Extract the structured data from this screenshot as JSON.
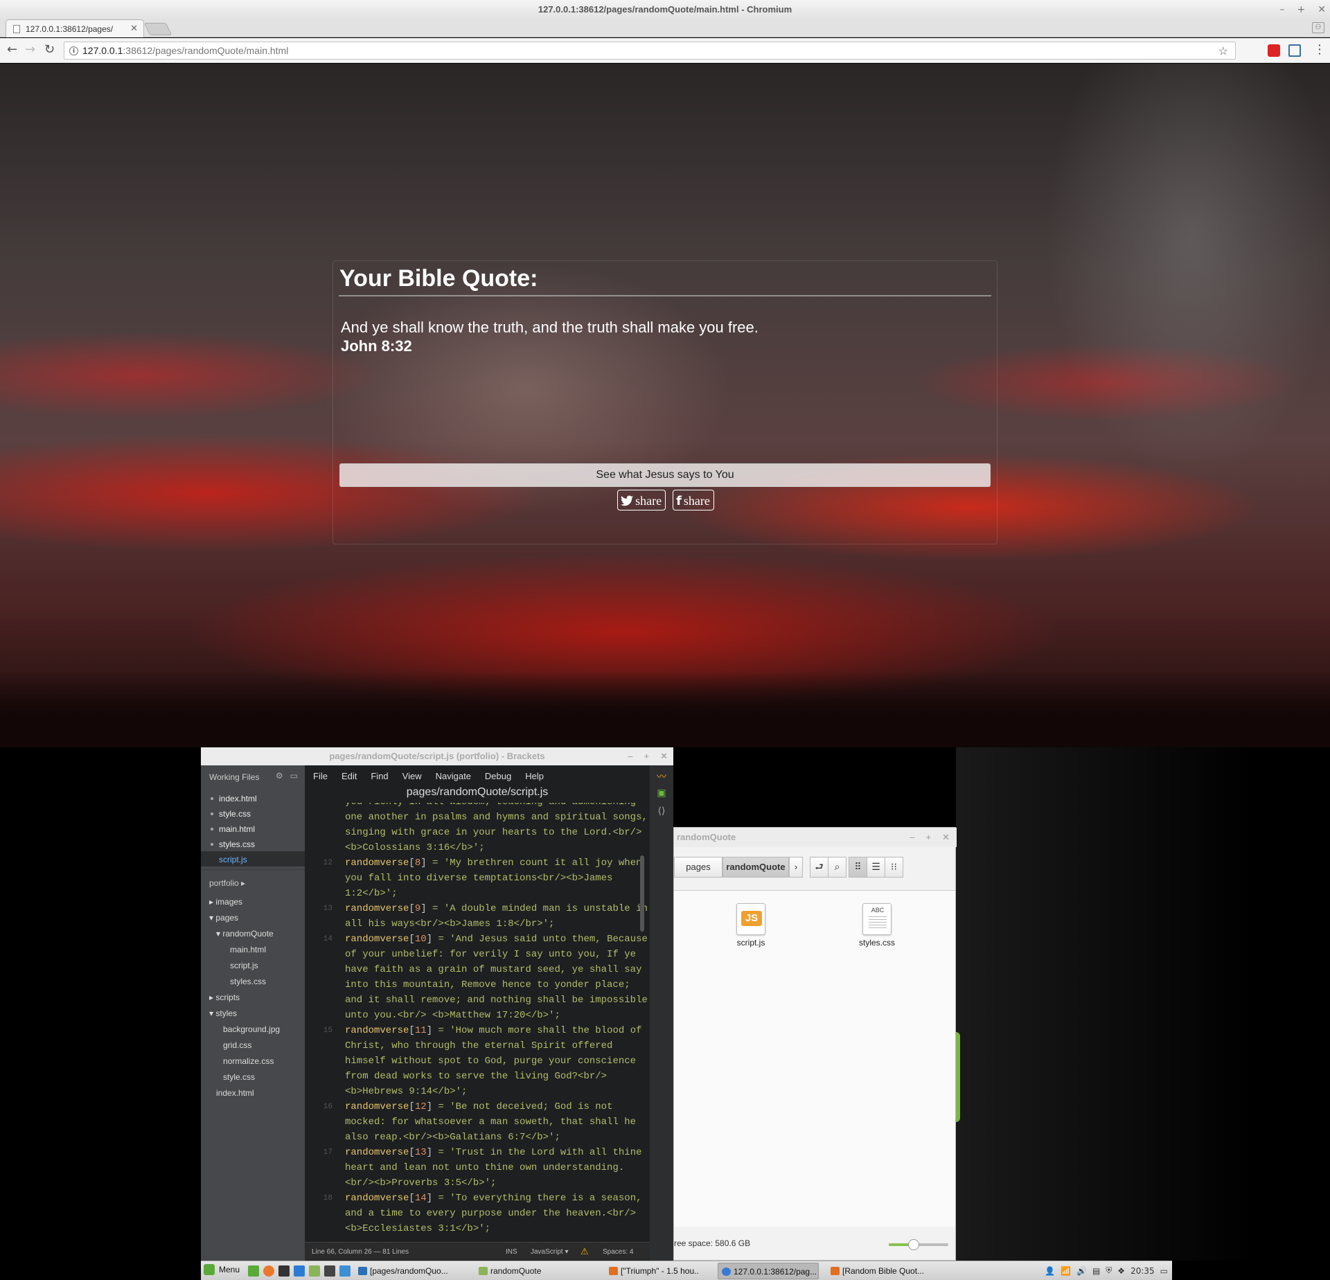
{
  "window": {
    "title": "127.0.0.1:38612/pages/randomQuote/main.html - Chromium",
    "minimize": "–",
    "maximize": "+",
    "close": "✕"
  },
  "browser": {
    "tab_title": "127.0.0.1:38612/pages/",
    "tab_close": "✕",
    "profile": "⚇",
    "url_host": "127.0.0.1",
    "url_rest": ":38612/pages/randomQuote/main.html",
    "back": "←",
    "forward": "→",
    "reload": "↻",
    "star": "☆",
    "info": "i",
    "menu": "⋮"
  },
  "quote_page": {
    "heading": "Your Bible Quote:",
    "quote": "And ye shall know the truth, and the truth shall make you free.",
    "reference": "John 8:32",
    "button_label": "See what Jesus says to You",
    "twitter_share": "share",
    "facebook_share": "share",
    "twitter_icon": "twitter-bird",
    "facebook_icon": "f"
  },
  "brackets": {
    "title": "pages/randomQuote/script.js (portfolio) - Brackets",
    "ctrl_min": "–",
    "ctrl_max": "+",
    "ctrl_close": "✕",
    "working_files_label": "Working Files",
    "working_files": [
      "index.html",
      "style.css",
      "main.html",
      "styles.css",
      "script.js"
    ],
    "project_label": "portfolio ▸",
    "tree": [
      {
        "label": "▸ images"
      },
      {
        "label": "▾ pages"
      },
      {
        "label": "▾ randomQuote"
      },
      {
        "label": "main.html"
      },
      {
        "label": "script.js"
      },
      {
        "label": "styles.css"
      },
      {
        "label": "▸ scripts"
      },
      {
        "label": "▾ styles"
      },
      {
        "label": "background.jpg"
      },
      {
        "label": "grid.css"
      },
      {
        "label": "normalize.css"
      },
      {
        "label": "style.css"
      },
      {
        "label": "index.html"
      }
    ],
    "menu": [
      "File",
      "Edit",
      "Find",
      "View",
      "Navigate",
      "Debug",
      "Help"
    ],
    "file_path": "pages/randomQuote/script.js",
    "code": [
      {
        "ln": "",
        "text": "you richly in all wisdom; teaching and admonishing"
      },
      {
        "ln": "",
        "text": "one another in psalms and hymns and spiritual songs,"
      },
      {
        "ln": "",
        "text": "singing with grace in your hearts to the Lord.<br/>"
      },
      {
        "ln": "",
        "text": "<b>Colossians 3:16</b>';"
      },
      {
        "ln": "12",
        "kw": "randomverse",
        "num": "8",
        "text": " = 'My brethren count it all joy when"
      },
      {
        "ln": "",
        "text": "you fall into diverse temptations<br/><b>James"
      },
      {
        "ln": "",
        "text": "1:2</b>';"
      },
      {
        "ln": "13",
        "kw": "randomverse",
        "num": "9",
        "text": " = 'A double minded man is unstable in"
      },
      {
        "ln": "",
        "text": "all his ways<br/><b>James 1:8</br>';"
      },
      {
        "ln": "14",
        "kw": "randomverse",
        "num": "10",
        "text": " = 'And Jesus said unto them, Because"
      },
      {
        "ln": "",
        "text": "of your unbelief: for verily I say unto you, If ye"
      },
      {
        "ln": "",
        "text": "have faith as a grain of mustard seed, ye shall say"
      },
      {
        "ln": "",
        "text": "into this mountain, Remove hence to yonder place;"
      },
      {
        "ln": "",
        "text": "and it shall remove; and nothing shall be impossible"
      },
      {
        "ln": "",
        "text": "unto you.<br/> <b>Matthew 17:20</b>';"
      },
      {
        "ln": "15",
        "kw": "randomverse",
        "num": "11",
        "text": " = 'How much more shall the blood of"
      },
      {
        "ln": "",
        "text": "Christ, who through the eternal Spirit offered"
      },
      {
        "ln": "",
        "text": "himself without spot to God, purge your conscience"
      },
      {
        "ln": "",
        "text": "from dead works to serve the living God?<br/>"
      },
      {
        "ln": "",
        "text": "<b>Hebrews 9:14</b>';"
      },
      {
        "ln": "16",
        "kw": "randomverse",
        "num": "12",
        "text": " = 'Be not deceived; God is not"
      },
      {
        "ln": "",
        "text": "mocked: for whatsoever a man soweth, that shall he"
      },
      {
        "ln": "",
        "text": "also reap.<br/><b>Galatians 6:7</b>';"
      },
      {
        "ln": "17",
        "kw": "randomverse",
        "num": "13",
        "text": " = 'Trust in the Lord with all thine"
      },
      {
        "ln": "",
        "text": "heart and lean not unto thine own understanding."
      },
      {
        "ln": "",
        "text": "<br/><b>Proverbs 3:5</b>';"
      },
      {
        "ln": "18",
        "kw": "randomverse",
        "num": "14",
        "text": " = 'To everything there is a season,"
      },
      {
        "ln": "",
        "text": "and a time to every purpose under the heaven.<br/>"
      },
      {
        "ln": "",
        "text": "<b>Ecclesiastes 3:1</b>';"
      }
    ],
    "status": {
      "cursor": "Line 66, Column 26 — 81 Lines",
      "mode": "INS",
      "language": "JavaScript ▾",
      "warning": "⚠",
      "spaces": "Spaces: 4"
    }
  },
  "file_manager": {
    "title": "randomQuote",
    "ctrl_min": "–",
    "ctrl_max": "+",
    "ctrl_close": "✕",
    "breadcrumbs": [
      "pages",
      "randomQuote"
    ],
    "crumb_next": "›",
    "files": [
      {
        "name": "script.js",
        "icon": "JS"
      },
      {
        "name": "styles.css",
        "icon": "ABC"
      }
    ],
    "free_space": "ree space: 580.6 GB",
    "zoom_level": 0.42
  },
  "taskbar": {
    "menu_label": "Menu",
    "windows": [
      {
        "label": "[pages/randomQuo...",
        "active": false
      },
      {
        "label": "randomQuote",
        "active": false
      },
      {
        "label": "[\"Triumph\" - 1.5 hou...",
        "active": false
      },
      {
        "label": "127.0.0.1:38612/pag...",
        "active": true
      },
      {
        "label": "[Random Bible Quot...",
        "active": false
      }
    ],
    "clock": "20:35"
  },
  "colors": {
    "editor_bg": "#1d1f21",
    "sidebar_bg": "#47484b",
    "keyword": "#e8c56a",
    "string": "#b5bd68",
    "number": "#de935f",
    "accent_link": "#6fb3ff"
  }
}
